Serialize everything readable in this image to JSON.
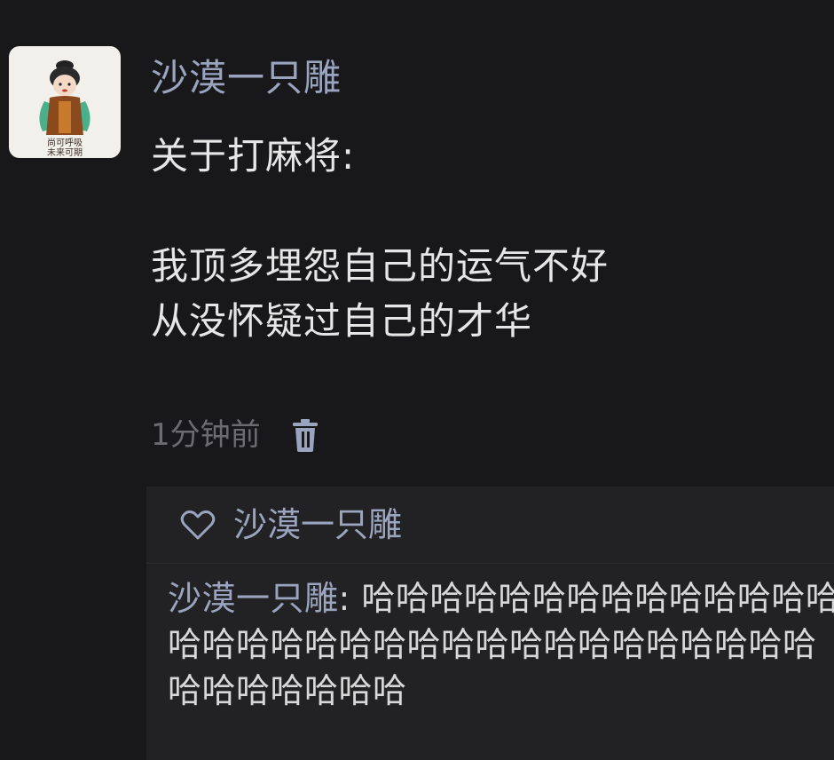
{
  "post": {
    "username": "沙漠一只雕",
    "avatar_text_line1": "尚可呼吸",
    "avatar_text_line2": "未来可期",
    "text": "关于打麻将:\n\n我顶多埋怨自己的运气不好\n从没怀疑过自己的才华",
    "timestamp": "1分钟前",
    "delete_icon": "trash-icon"
  },
  "likes": {
    "icon": "heart-icon",
    "names": "沙漠一只雕"
  },
  "comments": [
    {
      "author": "沙漠一只雕",
      "separator": ": ",
      "text": "哈哈哈哈哈哈哈哈哈哈哈哈哈哈哈哈哈哈哈哈哈哈哈哈哈哈哈哈哈哈哈哈哈哈哈哈哈哈哈哈"
    }
  ],
  "colors": {
    "background": "#18181a",
    "panel": "#222224",
    "name_link": "#9aa4be",
    "text": "#e6e6e6",
    "muted": "#6c6c70"
  }
}
